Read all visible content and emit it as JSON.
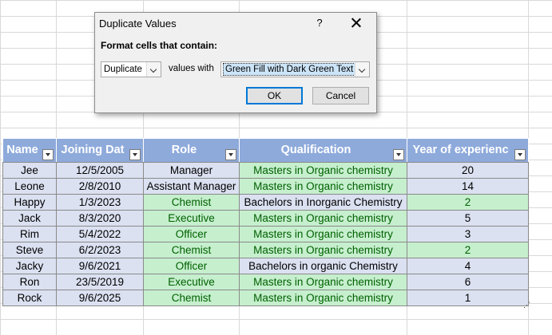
{
  "dialog": {
    "title": "Duplicate Values",
    "help_glyph": "?",
    "prompt": "Format cells that contain:",
    "match_type": "Duplicate",
    "values_with_label": "values with",
    "format_style": "Green Fill with Dark Green Text",
    "ok_label": "OK",
    "cancel_label": "Cancel"
  },
  "table": {
    "headers": [
      "Name",
      "Joining Dat",
      "Role",
      "Qualification",
      "Year of experienc"
    ],
    "rows": [
      {
        "name": "Jee",
        "date": "12/5/2005",
        "role": "Manager",
        "qual": "Masters in Organic chemistry",
        "years": "20"
      },
      {
        "name": "Leone",
        "date": "2/8/2010",
        "role": "Assistant Manager",
        "qual": "Masters in Organic chemistry",
        "years": "14"
      },
      {
        "name": "Happy",
        "date": "1/3/2023",
        "role": "Chemist",
        "qual": "Bachelors in Inorganic Chemistry",
        "years": "2"
      },
      {
        "name": "Jack",
        "date": "8/3/2020",
        "role": "Executive",
        "qual": "Masters in Organic chemistry",
        "years": "5"
      },
      {
        "name": "Rim",
        "date": "5/4/2022",
        "role": "Officer",
        "qual": "Masters in Organic chemistry",
        "years": "3"
      },
      {
        "name": "Steve",
        "date": "6/2/2023",
        "role": "Chemist",
        "qual": "Masters in Organic chemistry",
        "years": "2"
      },
      {
        "name": "Jacky",
        "date": "9/6/2021",
        "role": "Officer",
        "qual": "Bachelors in organic Chemistry",
        "years": "4"
      },
      {
        "name": "Ron",
        "date": "23/5/2019",
        "role": "Executive",
        "qual": "Masters in Organic chemistry",
        "years": "6"
      },
      {
        "name": "Rock",
        "date": "9/6/2025",
        "role": "Chemist",
        "qual": "Masters in Organic chemistry",
        "years": "1"
      }
    ]
  },
  "colors": {
    "header_fill": "#8eaadb",
    "row_fill": "#dbe1f1",
    "duplicate_fill": "#c6efce",
    "duplicate_text": "#006100"
  }
}
